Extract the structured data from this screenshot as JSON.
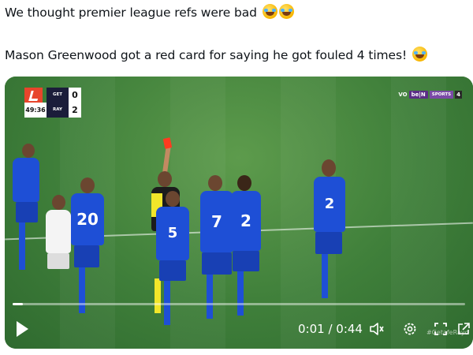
{
  "tweet": {
    "line1": "We thought premier league refs were bad",
    "line1_emoji": [
      "face-with-tears-of-joy",
      "face-with-tears-of-joy"
    ],
    "line2": "Mason Greenwood got a red card for saying he got fouled 4 times!",
    "line2_emoji": [
      "face-with-tears-of-joy"
    ]
  },
  "scoreboard": {
    "time": "49:36",
    "home_team": "GET",
    "home_score": "0",
    "away_team": "RAY",
    "away_score": "2"
  },
  "broadcaster": {
    "vo": "VO",
    "bein": "be|N",
    "sports": "SPORTS",
    "channel": "4"
  },
  "players": {
    "shirt_numbers": [
      "20",
      "5",
      "7",
      "2",
      "2"
    ]
  },
  "player_controls": {
    "current_time": "0:01",
    "separator": " / ",
    "duration": "0:44",
    "progress_fraction": 0.023,
    "watermark": "#GetafeRayo"
  },
  "colors": {
    "home_kit": "#1e4fd6",
    "red_card": "#ff3b1f",
    "referee_vest": "#f2e62a"
  }
}
